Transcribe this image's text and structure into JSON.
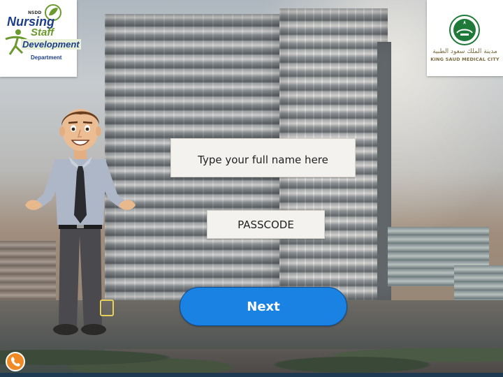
{
  "left_logo": {
    "tag": "NSDD",
    "word1": "Nursing",
    "word2": "Staff",
    "word3": "Development",
    "word4": "Department"
  },
  "right_logo": {
    "arabic_text": "مدينة الملك سعود الطبية",
    "english_text": "KING SAUD MEDICAL CITY"
  },
  "form": {
    "name_placeholder": "Type your full name here",
    "name_value": "",
    "passcode_placeholder": "PASSCODE",
    "passcode_value": "",
    "next_label": "Next"
  },
  "icons": {
    "call": "phone-icon",
    "avatar": "presenter-character",
    "emblem": "ksmc-emblem-icon"
  },
  "colors": {
    "next_button": "#1a82e2",
    "call_button": "#f08a24",
    "nsdd_blue": "#1d3f8a",
    "nsdd_green": "#6a9a2e",
    "ksmc_gold": "#7a6a3c"
  }
}
